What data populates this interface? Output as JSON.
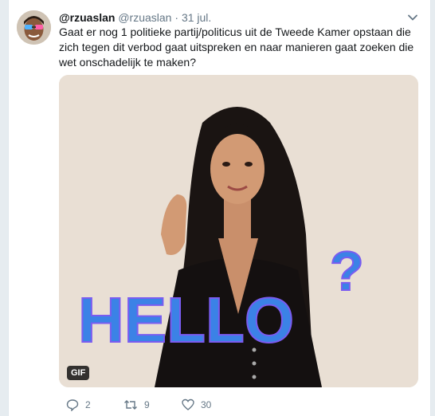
{
  "tweet": {
    "display_name": "@rzuaslan",
    "handle": "@rzuaslan",
    "separator": "·",
    "date": "31 jul.",
    "text": "Gaat er nog 1 politieke partij/politicus uit de Tweede Kamer opstaan die zich tegen dit verbod gaat uitspreken en naar manieren gaat zoeken die wet onschadelijk te maken?",
    "media": {
      "badge": "GIF",
      "overlay_text": "HELLO",
      "overlay_symbol": "?",
      "overlay_color": "#3b82e6",
      "background_color": "#e9dfd4"
    },
    "actions": {
      "reply_count": "2",
      "retweet_count": "9",
      "like_count": "30"
    }
  },
  "icons": {
    "reply": "reply-icon",
    "retweet": "retweet-icon",
    "like": "heart-icon",
    "share": "share-icon",
    "caret": "chevron-down-icon"
  }
}
